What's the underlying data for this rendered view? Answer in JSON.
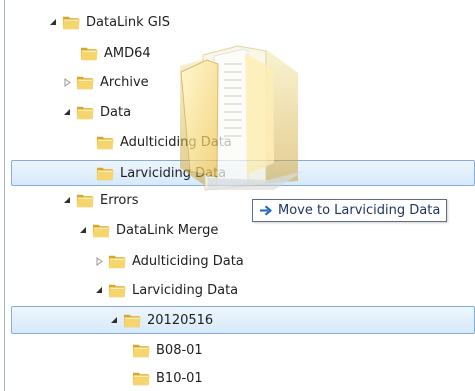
{
  "tree": {
    "items": [
      {
        "label": "DataLink GIS",
        "state": "expanded"
      },
      {
        "label": "AMD64",
        "state": "none"
      },
      {
        "label": "Archive",
        "state": "collapsed"
      },
      {
        "label": "Data",
        "state": "expanded"
      },
      {
        "label": "Adulticiding Data",
        "state": "none"
      },
      {
        "label": "Larviciding Data",
        "state": "none",
        "selected": true
      },
      {
        "label": "Errors",
        "state": "expanded"
      },
      {
        "label": "DataLink Merge",
        "state": "expanded"
      },
      {
        "label": "Adulticiding Data",
        "state": "collapsed"
      },
      {
        "label": "Larviciding Data",
        "state": "expanded"
      },
      {
        "label": "20120516",
        "state": "expanded",
        "selected": true
      },
      {
        "label": "B08-01",
        "state": "none"
      },
      {
        "label": "B10-01",
        "state": "none"
      }
    ]
  },
  "drag": {
    "tooltip_text": "Move to Larviciding Data",
    "icon": "folder-drag-ghost-icon"
  },
  "colors": {
    "selection_fill_top": "#eef6fd",
    "selection_fill_bottom": "#d6e9fb",
    "selection_border": "#84acdd",
    "folder_main": "#f2c94c",
    "folder_dark": "#c99b27",
    "arrow": "#1f65c6"
  }
}
